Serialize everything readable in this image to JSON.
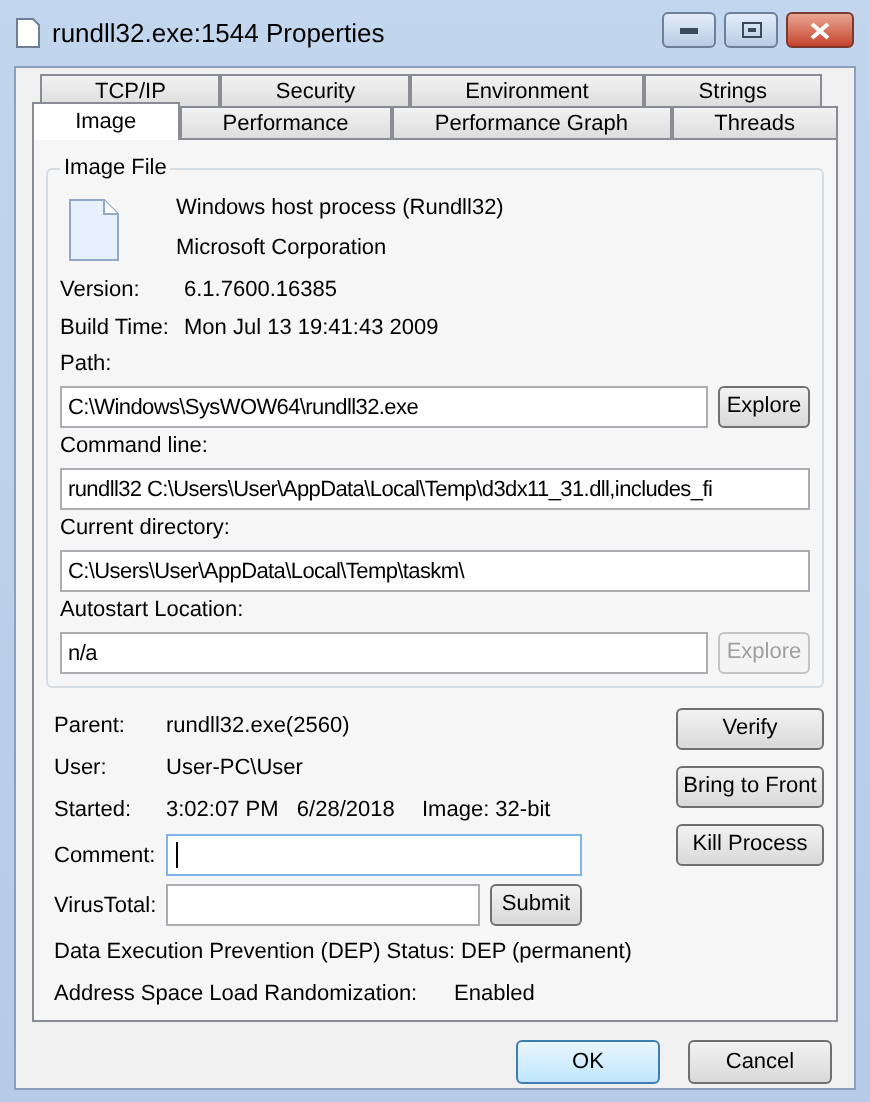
{
  "window": {
    "title": "rundll32.exe:1544 Properties"
  },
  "tab_rows": [
    [
      {
        "label": "TCP/IP",
        "selected": false
      },
      {
        "label": "Security",
        "selected": false
      },
      {
        "label": "Environment",
        "selected": false
      },
      {
        "label": "Strings",
        "selected": false
      }
    ],
    [
      {
        "label": "Image",
        "selected": true
      },
      {
        "label": "Performance",
        "selected": false
      },
      {
        "label": "Performance Graph",
        "selected": false
      },
      {
        "label": "Threads",
        "selected": false
      }
    ]
  ],
  "image_file": {
    "legend": "Image File",
    "description": "Windows host process (Rundll32)",
    "company": "Microsoft Corporation",
    "details": [
      {
        "label": "Version:",
        "value": "6.1.7600.16385"
      },
      {
        "label": "Build Time:",
        "value": "Mon Jul 13 19:41:43 2009"
      }
    ],
    "fields": [
      {
        "label": "Path:",
        "value": "C:\\Windows\\SysWOW64\\rundll32.exe",
        "button": {
          "label": "Explore",
          "disabled": false
        }
      },
      {
        "label": "Command line:",
        "value": "rundll32  C:\\Users\\User\\AppData\\Local\\Temp\\d3dx11_31.dll,includes_fi"
      },
      {
        "label": "Current directory:",
        "value": "C:\\Users\\User\\AppData\\Local\\Temp\\taskm\\"
      },
      {
        "label": "Autostart Location:",
        "value": "n/a",
        "button": {
          "label": "Explore",
          "disabled": true
        }
      }
    ]
  },
  "process": {
    "parent": {
      "label": "Parent:",
      "value": "rundll32.exe(2560)"
    },
    "user": {
      "label": "User:",
      "value": "User-PC\\User"
    },
    "started": {
      "label": "Started:",
      "value": "3:02:07 PM   6/28/2018",
      "image": "Image: 32-bit"
    },
    "comment": {
      "label": "Comment:"
    },
    "virustotal": {
      "label": "VirusTotal:",
      "button": "Submit"
    },
    "dep": {
      "label": "Data Execution Prevention (DEP) Status:",
      "value": "DEP (permanent)"
    },
    "aslr": {
      "label": "Address Space Load Randomization:",
      "value": "Enabled"
    }
  },
  "side_buttons": [
    "Verify",
    "Bring to Front",
    "Kill Process"
  ],
  "footer_buttons": [
    {
      "label": "OK",
      "default": true
    },
    {
      "label": "Cancel",
      "default": false
    }
  ]
}
